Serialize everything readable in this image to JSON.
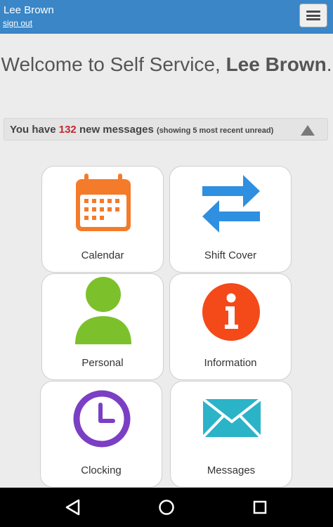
{
  "header": {
    "user_name": "Lee Brown",
    "sign_out": "sign out",
    "menu_icon": "hamburger-menu-icon"
  },
  "welcome": {
    "prefix": "Welcome to Self Service, ",
    "name": "Lee Brown",
    "suffix": "."
  },
  "messages": {
    "prefix": "You have ",
    "count": "132",
    "suffix": " new messages",
    "note": "(showing 5 most recent unread)",
    "toggle_icon": "collapse-triangle-icon"
  },
  "tiles": [
    {
      "label": "Calendar",
      "icon": "calendar-icon"
    },
    {
      "label": "Shift Cover",
      "icon": "swap-arrows-icon"
    },
    {
      "label": "Personal",
      "icon": "person-icon"
    },
    {
      "label": "Information",
      "icon": "info-icon"
    },
    {
      "label": "Clocking",
      "icon": "clock-icon"
    },
    {
      "label": "Messages",
      "icon": "envelope-icon"
    }
  ],
  "nav": {
    "back_icon": "back-triangle-icon",
    "home_icon": "home-circle-icon",
    "recents_icon": "recents-square-icon"
  },
  "colors": {
    "header": "#3a86c7",
    "count": "#c0282e",
    "calendar": "#f47b2a",
    "arrows": "#2f8fe0",
    "person": "#7cc12b",
    "info": "#f44a1a",
    "clock": "#7b3fc4",
    "envelope": "#2bb3c8"
  }
}
